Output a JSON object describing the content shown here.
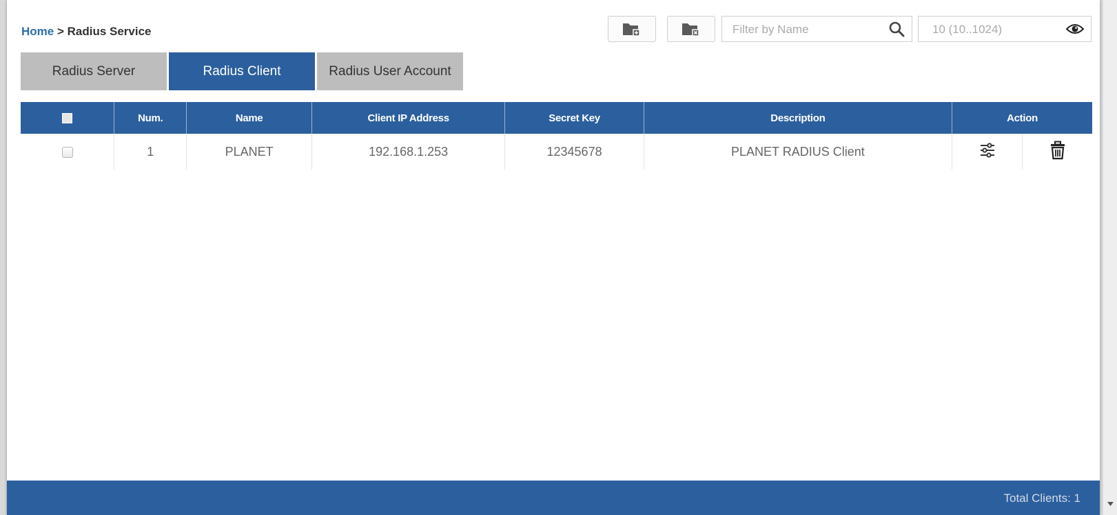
{
  "breadcrumb": {
    "home": "Home",
    "separator": " > ",
    "current": "Radius Service"
  },
  "toolbar": {
    "add_icon": "folder-add-icon",
    "delete_icon": "folder-delete-icon",
    "filter_placeholder": "Filter by Name",
    "search_icon": "search-icon",
    "page_size_placeholder": "10 (10..1024)",
    "view_icon": "eye-icon"
  },
  "tabs": [
    {
      "label": "Radius Server",
      "active": false
    },
    {
      "label": "Radius Client",
      "active": true
    },
    {
      "label": "Radius User Account",
      "active": false
    }
  ],
  "table": {
    "columns": [
      "Num.",
      "Name",
      "Client IP Address",
      "Secret Key",
      "Description",
      "Action"
    ],
    "rows": [
      {
        "num": "1",
        "name": "PLANET",
        "ip": "192.168.1.253",
        "secret": "12345678",
        "description": "PLANET RADIUS Client",
        "actions": [
          "settings-sliders-icon",
          "trash-icon"
        ]
      }
    ]
  },
  "footer": {
    "total": "Total Clients: 1"
  },
  "colors": {
    "primary": "#2c5f9e",
    "tab_inactive": "#bdbdbd",
    "link": "#2e6da4"
  }
}
